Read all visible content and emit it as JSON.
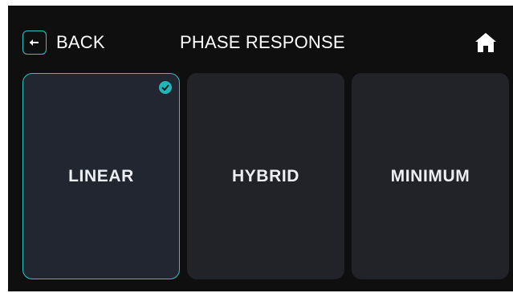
{
  "header": {
    "back_label": "BACK",
    "title": "PHASE RESPONSE",
    "back_icon": "arrow-left-icon",
    "home_icon": "home-icon"
  },
  "options": [
    {
      "label": "LINEAR",
      "selected": true
    },
    {
      "label": "HYBRID",
      "selected": false
    },
    {
      "label": "MINIMUM",
      "selected": false
    }
  ],
  "colors": {
    "background": "#0f0f0f",
    "tile": "#222328",
    "tile_selected": "#212631",
    "accent": "#2ec4c4",
    "text": "#ffffff"
  }
}
